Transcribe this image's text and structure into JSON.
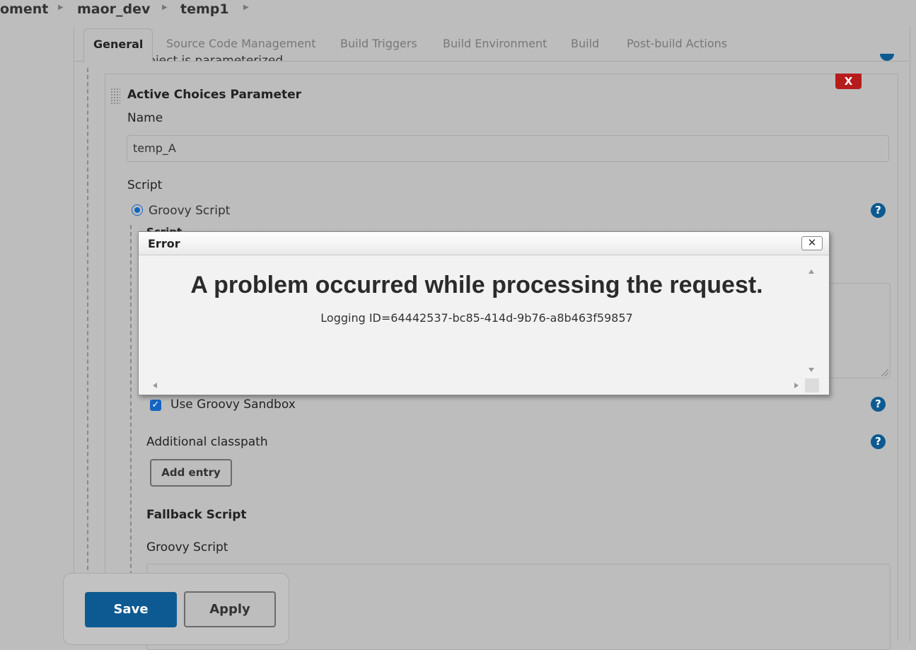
{
  "breadcrumb": {
    "items": [
      "oment",
      "maor_dev",
      "temp1"
    ]
  },
  "tabs": {
    "general": "General",
    "scm": "Source Code Management",
    "triggers": "Build Triggers",
    "environment": "Build Environment",
    "build": "Build",
    "post_build": "Post-build Actions"
  },
  "form": {
    "parameterized_label": "This project is parameterized",
    "delete_label": "X",
    "parameter_title": "Active Choices Parameter",
    "name_label": "Name",
    "name_value": "temp_A",
    "script_label": "Script",
    "groovy_option": "Groovy Script",
    "script_sublabel": "Script",
    "sandbox_label": "Use Groovy Sandbox",
    "classpath_label": "Additional classpath",
    "add_entry_label": "Add entry",
    "fallback_title": "Fallback Script",
    "fallback_groovy_label": "Groovy Script",
    "help_glyph": "?"
  },
  "actions": {
    "save_label": "Save",
    "apply_label": "Apply"
  },
  "dialog": {
    "title": "Error",
    "close_glyph": "✕",
    "heading": "A problem occurred while processing the request.",
    "logging_id": "Logging ID=64442537-bc85-414d-9b76-a8b463f59857"
  },
  "colors": {
    "accent": "#0d5a92",
    "danger": "#b71c1c",
    "overlay_bg": "#bdbdbd",
    "dialog_bg": "#f2f2f2"
  }
}
